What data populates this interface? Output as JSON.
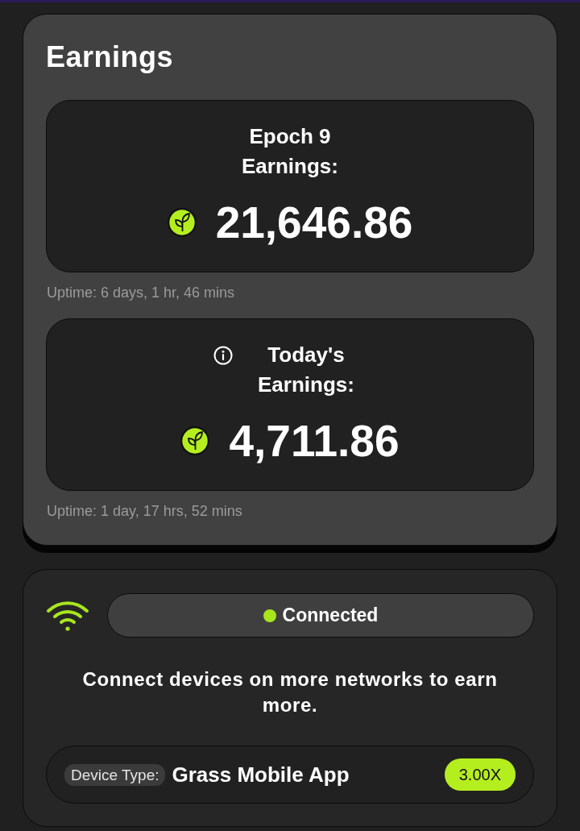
{
  "header": {
    "title": "Earnings"
  },
  "earnings": [
    {
      "kind": "epoch",
      "label": "Epoch 9 Earnings:",
      "info": false,
      "amount": "21,646.86",
      "uptime": "Uptime: 6 days, 1 hr, 46 mins"
    },
    {
      "kind": "today",
      "label": "Today's Earnings:",
      "info": true,
      "amount": "4,711.86",
      "uptime": "Uptime: 1 day, 17 hrs, 52 mins"
    }
  ],
  "connection": {
    "connected": true,
    "status": "Connected",
    "message": "Connect devices on more networks to earn more.",
    "device": {
      "label": "Device Type:",
      "value": "Grass Mobile App",
      "multiplier": "3.00X"
    }
  }
}
